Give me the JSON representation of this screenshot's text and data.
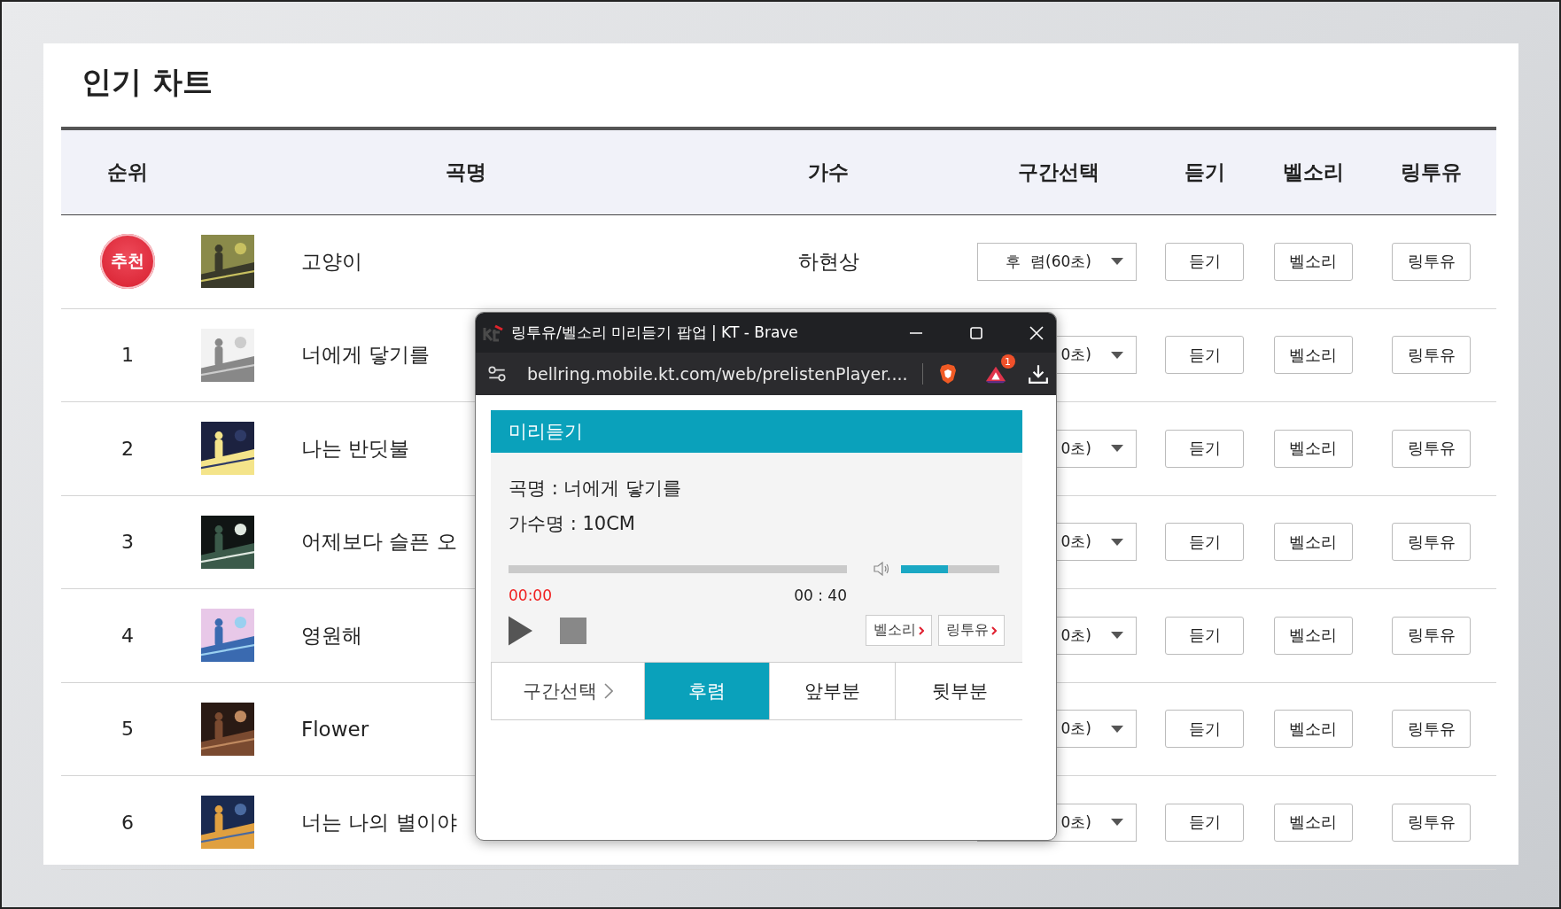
{
  "page_title": "인기 차트",
  "table": {
    "columns": [
      "순위",
      "곡명",
      "가수",
      "구간선택",
      "듣기",
      "벨소리",
      "링투유"
    ],
    "rows": [
      {
        "kind": "badge",
        "rank": "추천",
        "title": "고양이",
        "singer": "하현상",
        "section": "후  렴(60초)",
        "buttons": [
          "듣기",
          "벨소리",
          "링투유"
        ]
      },
      {
        "kind": "number",
        "rank": "1",
        "title": "너에게 닿기를",
        "section": "0초)",
        "buttons": [
          "듣기",
          "벨소리",
          "링투유"
        ]
      },
      {
        "kind": "number",
        "rank": "2",
        "title": "나는 반딧불",
        "section": "0초)",
        "buttons": [
          "듣기",
          "벨소리",
          "링투유"
        ]
      },
      {
        "kind": "number",
        "rank": "3",
        "title": "어제보다 슬픈 오",
        "section": "0초)",
        "buttons": [
          "듣기",
          "벨소리",
          "링투유"
        ]
      },
      {
        "kind": "number",
        "rank": "4",
        "title": "영원해",
        "section": "0초)",
        "buttons": [
          "듣기",
          "벨소리",
          "링투유"
        ]
      },
      {
        "kind": "number",
        "rank": "5",
        "title": "Flower",
        "section": "0초)",
        "buttons": [
          "듣기",
          "벨소리",
          "링투유"
        ]
      },
      {
        "kind": "number",
        "rank": "6",
        "title": "너는 나의 별이야",
        "section": "0초)",
        "buttons": [
          "듣기",
          "벨소리",
          "링투유"
        ]
      }
    ]
  },
  "popup": {
    "window_title": "링투유/벨소리 미리듣기 팝업 | KT - Brave",
    "url": "bellring.mobile.kt.com/web/prelistenPlayer....",
    "notification_count": "1",
    "heading": "미리듣기",
    "song_line": "곡명 : 너에게 닿기를",
    "artist_line": "가수명 : 10CM",
    "progress": {
      "level": 0
    },
    "volume": {
      "level": 0.48
    },
    "elapsed": "00:00",
    "duration": "00 : 40",
    "actions": [
      "벨소리",
      "링투유"
    ],
    "section_label": "구간선택",
    "sections": [
      {
        "label": "후렴",
        "selected": true
      },
      {
        "label": "앞부분",
        "selected": false
      },
      {
        "label": "뒷부분",
        "selected": false
      }
    ]
  }
}
